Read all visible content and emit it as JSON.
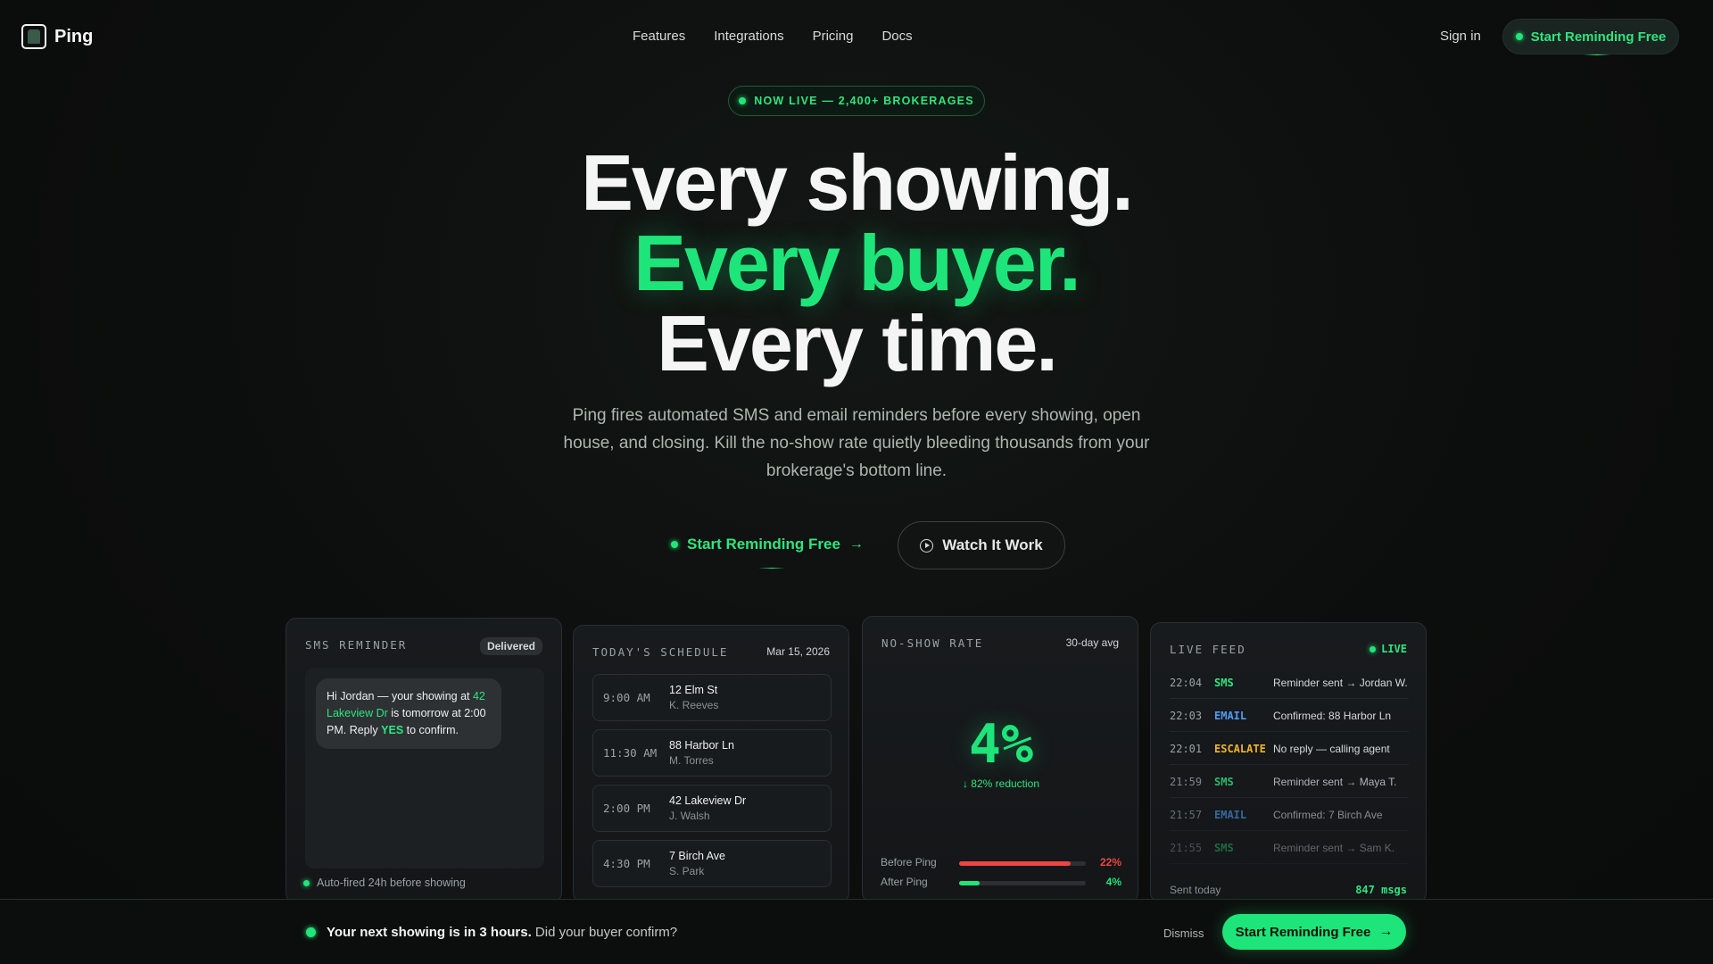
{
  "nav": {
    "brand": "Ping",
    "links": [
      "Features",
      "Integrations",
      "Pricing",
      "Docs"
    ],
    "signin": "Sign in",
    "cta": "Start Reminding Free"
  },
  "hero": {
    "badge": "NOW LIVE — 2,400+ BROKERAGES",
    "line1": "Every showing.",
    "line2": "Every buyer.",
    "line3": "Every time.",
    "subhead": "Ping fires automated SMS and email reminders before every showing, open house, and closing. Kill the no-show rate quietly bleeding thousands from your brokerage's bottom line.",
    "cta_primary": "Start Reminding Free",
    "cta_secondary": "Watch It Work"
  },
  "sms_card": {
    "title": "SMS REMINDER",
    "status": "Delivered",
    "message_a": "Hi Jordan — your showing at ",
    "message_addr": "42 Lakeview Dr",
    "message_b": " is tomorrow at 2:00 PM. Reply ",
    "message_yes": "YES",
    "message_c": " to confirm.",
    "footer": "Auto-fired 24h before showing"
  },
  "schedule_card": {
    "title": "TODAY'S SCHEDULE",
    "date": "Mar 15, 2026",
    "rows": [
      {
        "time": "9:00 AM",
        "address": "12 Elm St",
        "agent": "K. Reeves"
      },
      {
        "time": "11:30 AM",
        "address": "88 Harbor Ln",
        "agent": "M. Torres"
      },
      {
        "time": "2:00 PM",
        "address": "42 Lakeview Dr",
        "agent": "J. Walsh"
      },
      {
        "time": "4:30 PM",
        "address": "7 Birch Ave",
        "agent": "S. Park"
      }
    ]
  },
  "noshow_card": {
    "title": "NO-SHOW RATE",
    "meta": "30-day avg",
    "value": "4%",
    "reduction": "↓ 82% reduction",
    "bars": [
      {
        "label": "Before Ping",
        "value": "22%",
        "fill": 0.88,
        "color": "#f04444"
      },
      {
        "label": "After Ping",
        "value": "4%",
        "fill": 0.16,
        "color": "#1ee57a"
      }
    ]
  },
  "feed_card": {
    "title": "LIVE FEED",
    "live": "LIVE",
    "rows": [
      {
        "time": "22:04",
        "type": "SMS",
        "color": "#2ee57f",
        "msg": "Reminder sent → Jordan W.",
        "opacity": 1
      },
      {
        "time": "22:03",
        "type": "EMAIL",
        "color": "#4f9cf5",
        "msg": "Confirmed: 88 Harbor Ln",
        "opacity": 1
      },
      {
        "time": "22:01",
        "type": "ESCALATE",
        "color": "#f0b429",
        "msg": "No reply — calling agent",
        "opacity": 1
      },
      {
        "time": "21:59",
        "type": "SMS",
        "color": "#2ee57f",
        "msg": "Reminder sent → Maya T.",
        "opacity": 0.8
      },
      {
        "time": "21:57",
        "type": "EMAIL",
        "color": "#4f9cf5",
        "msg": "Confirmed: 7 Birch Ave",
        "opacity": 0.6
      },
      {
        "time": "21:55",
        "type": "SMS",
        "color": "#2ee57f",
        "msg": "Reminder sent → Sam K.",
        "opacity": 0.4
      }
    ],
    "sent_label": "Sent today",
    "sent_value": "847 msgs"
  },
  "bottom_bar": {
    "bold": "Your next showing is in 3 hours.",
    "rest": " Did your buyer confirm?",
    "dismiss": "Dismiss",
    "cta": "Start Reminding Free"
  }
}
